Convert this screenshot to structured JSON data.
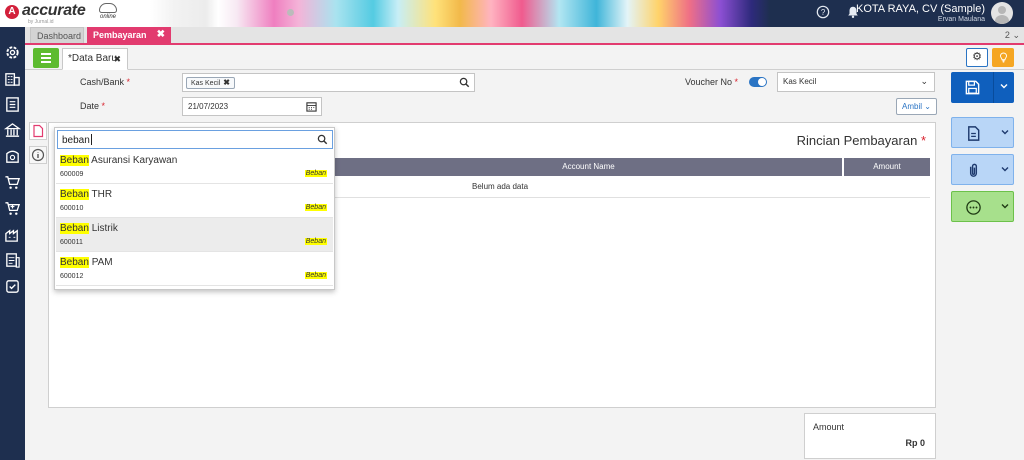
{
  "header": {
    "logo_text": "accurate",
    "logo_suffix": "online",
    "logo_tagline": "by Jurnal.id",
    "company_name": "KOTA RAYA, CV (Sample)",
    "user_name": "Ervan Maulana",
    "help_icon": "help-icon",
    "notification_icon": "bell-icon"
  },
  "module_tabs": [
    {
      "label": "Dashboard",
      "active": false
    },
    {
      "label": "Pembayaran",
      "active": true,
      "close": "✖"
    }
  ],
  "tab_count": "2",
  "sub_tab": {
    "label": "*Data Baru",
    "close": "✖"
  },
  "form": {
    "cash_bank_label": "Cash/Bank",
    "cash_bank_value": "Kas Kecil",
    "required_mark": "*",
    "date_label": "Date",
    "date_value": "21/07/2023",
    "voucher_label": "Voucher No",
    "voucher_toggle_on": true,
    "voucher_value": "Kas Kecil",
    "ambil_label": "Ambil"
  },
  "panel": {
    "title": "Rincian Pembayaran",
    "columns": [
      "Account Name",
      "Amount"
    ],
    "empty_text": "Belum ada data"
  },
  "dropdown": {
    "search_value": "beban",
    "items": [
      {
        "highlight": "Beban",
        "name_rest": " Asuransi Karyawan",
        "code": "600009",
        "tag": "Beban"
      },
      {
        "highlight": "Beban",
        "name_rest": " THR",
        "code": "600010",
        "tag": "Beban"
      },
      {
        "highlight": "Beban",
        "name_rest": " Listrik",
        "code": "600011",
        "tag": "Beban"
      },
      {
        "highlight": "Beban",
        "name_rest": " PAM",
        "code": "600012",
        "tag": "Beban"
      }
    ]
  },
  "summary": {
    "amount_label": "Amount",
    "amount_value": "Rp 0"
  },
  "colors": {
    "navy": "#1e2f4f",
    "pink_accent": "#e23b6f",
    "green": "#5dbb2f",
    "blue": "#0f5fbd",
    "highlight": "#ffff00"
  }
}
